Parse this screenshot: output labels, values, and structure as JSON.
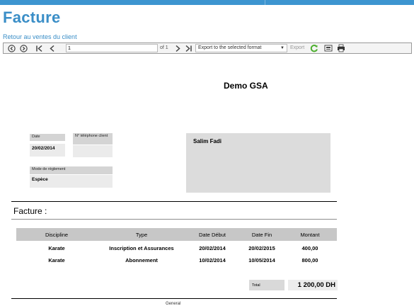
{
  "page": {
    "title": "Facture",
    "back_link": "Retour au ventes du client"
  },
  "toolbar": {
    "icons": [
      "first-page-circle-icon",
      "next-page-circle-icon",
      "first-page-icon",
      "previous-page-icon",
      "next-page-icon",
      "last-page-icon",
      "refresh-icon",
      "print-layout-icon",
      "print-icon"
    ],
    "page_number": "1",
    "page_of": "of 1",
    "export_format": "Export to the selected format",
    "export_label": "Export",
    "refresh_color": "#4caf2e"
  },
  "report": {
    "company": "Demo GSA",
    "date_label": "Date",
    "date_value": "20/02/2014",
    "phone_label": "N° téléphone client",
    "phone_value": "",
    "payment_label": "Mode de règlement",
    "payment_value": "Espèce",
    "client_name": "Salim Fadi",
    "section_label": "Facture :",
    "columns": [
      "Discipline",
      "Type",
      "Date Début",
      "Date Fin",
      "Montant"
    ],
    "rows": [
      [
        "Karate",
        "Inscription et Assurances",
        "20/02/2014",
        "20/02/2015",
        "400,00"
      ],
      [
        "Karate",
        "Abonnement",
        "10/02/2014",
        "10/05/2014",
        "800,00"
      ]
    ],
    "total_label": "Total",
    "total_value": "1 200,00 DH",
    "footer": "General"
  }
}
